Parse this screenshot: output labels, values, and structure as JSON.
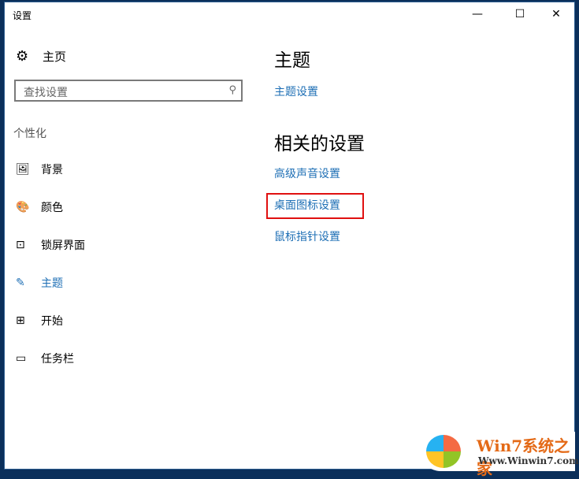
{
  "window": {
    "title": "设置",
    "minimize": "—",
    "maximize": "☐",
    "close": "✕"
  },
  "sidebar": {
    "home": "主页",
    "search_placeholder": "查找设置",
    "section": "个性化",
    "items": [
      {
        "label": "背景",
        "icon": "🖼"
      },
      {
        "label": "颜色",
        "icon": "🎨"
      },
      {
        "label": "锁屏界面",
        "icon": "⊡"
      },
      {
        "label": "主题",
        "icon": "✎"
      },
      {
        "label": "开始",
        "icon": "⊞"
      },
      {
        "label": "任务栏",
        "icon": "▭"
      }
    ]
  },
  "main": {
    "heading": "主题",
    "theme_link": "主题设置",
    "related_heading": "相关的设置",
    "links": [
      "高级声音设置",
      "桌面图标设置",
      "鼠标指针设置"
    ]
  },
  "watermark": {
    "title": "Win7系统之家",
    "url": "Www.Winwin7.com"
  },
  "colors": {
    "accent": "#1e6fb5",
    "highlight": "#e01010"
  }
}
